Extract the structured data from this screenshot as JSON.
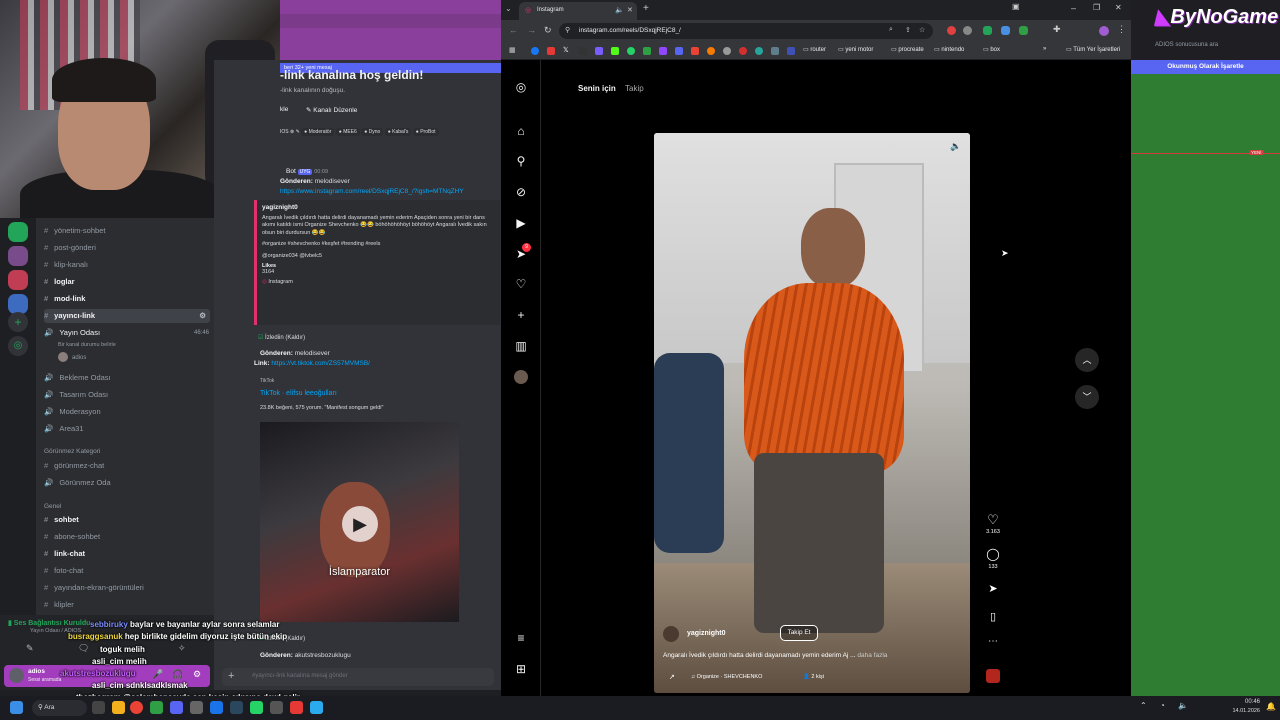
{
  "discord": {
    "channels_top": [
      "yönetim-sohbet",
      "post-gönderi",
      "klip-kanalı",
      "loglar",
      "mod-link",
      "yayıncı-link"
    ],
    "voice_room": "Yayın Odası",
    "voice_sub": "Bir kanal durumu belirle",
    "voice_user": "adios",
    "voice_count": "46:46",
    "rooms": [
      "Bekleme Odası",
      "Tasarım Odası",
      "Moderasyon",
      "Area31"
    ],
    "cat_hidden": "Görünmez Kategori",
    "hidden_channels": [
      "görünmez-chat",
      "Görünmez Oda"
    ],
    "cat_general": "Genel",
    "general_channels": [
      "sohbet",
      "abone-sohbet",
      "link-chat",
      "foto-chat",
      "yayından-ekran-görüntüleri",
      "klipler"
    ],
    "voice_status": "Ses Bağlantısı Kuruldu",
    "voice_status_sub": "Yayın Odası / ADIOS",
    "self_user": "adios",
    "self_status": "Sessi aramada",
    "new_msg_banner": "beri 32+ yeni mesaj",
    "welcome": "-link kanalına hoş geldin!",
    "welcome_sub": "-link kanalının doğuşu.",
    "edit_btn": "Kanalı Düzenle",
    "edit_btn_left": "kle",
    "roles": [
      "Moderatör",
      "MEE6",
      "Dyno",
      "Kabal's",
      "ProBot"
    ],
    "msg1_author": "Bot",
    "msg1_tag": "UYG",
    "msg1_time": "00:09",
    "msg1_from_label": "Gönderen:",
    "msg1_from": "melodisever",
    "msg1_link": "https://www.instagram.com/reel/DSxqjREjC8_/?igsh=MTNqZHY",
    "msg1_user": "yagiznight0",
    "msg1_body": "Angaralı İvedik çıldırdı hatta delirdi dayanamadı yemin ederim Apaçiden sonra yeni bir dans akımı katıldı ismi Organize Shevchenko 😂😂 böhöhöhöhöyt böhöhöyt Angaralı İvedik sakın olsun biri durdursun 😂😂",
    "msg1_tags": "#organize #shevchenko #keşfet #trending #reels",
    "msg1_mentions": "@organize034 @lvbelc5",
    "msg1_likes_label": "Likes",
    "msg1_likes": "3164",
    "msg1_source": "Instagram",
    "watched": "İzlediin (Kaldır)",
    "msg2_from_label": "Gönderen:",
    "msg2_from": "melodisever",
    "msg2_link_label": "Link:",
    "msg2_link": "https://vt.tiktok.com/ZS57MVMSB/",
    "tiktok_label": "TikTok",
    "tiktok_title": "TikTok · elifsu leeoğulları",
    "tiktok_meta": "23.8K beğeni, 575 yorum. \"Manifest songum geldi\"",
    "video_caption": "İslamparator",
    "watched2": "İzlediin (Kaldır)",
    "msg3_from_label": "Gönderen:",
    "msg3_from": "akutstresbozuklugu",
    "input_placeholder": "#yayıncı-link kanalına mesaj gönder"
  },
  "browser": {
    "tab_title": "Instagram",
    "url": "instagram.com/reels/DSxqjREjC8_/",
    "bookmarks": [
      "router",
      "yeni motor",
      "procreate",
      "nintendo",
      "box"
    ],
    "bookmarks_all": "Tüm Yer İşaretleri"
  },
  "instagram": {
    "tab_for_you": "Senin için",
    "tab_following": "Takip",
    "notif_count": "9",
    "likes": "3.163",
    "comments": "133",
    "user": "yagiznight0",
    "follow": "Takip Et",
    "caption": "Angaralı İvedik çıldırdı hatta delirdi dayanamadı yemin ederim Aj ...",
    "more": "daha fazla",
    "audio": "Organize · SHEVCHENKO",
    "people": "2 kişi"
  },
  "right_panel": {
    "brand": "ByNoGame",
    "sub": "ADIOS sonucusuna ara",
    "mark_read": "Okunmuş Olarak İşaretle",
    "new_badge": "YENİ"
  },
  "chat_overlay": [
    {
      "user": "sebbiruky",
      "msg": "baylar ve bayanlar aylar sonra selamlar",
      "color": "#7b8cff"
    },
    {
      "user": "busraggsanuk",
      "msg": "hep birlikte gidelim diyoruz işte bütün ekip",
      "color": "#f0d840"
    },
    {
      "user": "toguk",
      "msg": "melih",
      "color": "#ffffff"
    },
    {
      "user": "asli_cim",
      "msg": "melih",
      "color": "#ffffff"
    },
    {
      "user": "akutstresbozuklugu",
      "msg": "",
      "color": "#c45cff"
    },
    {
      "user": "asli_cim",
      "msg": "sdnklsadklsmak",
      "color": "#ffffff"
    },
    {
      "user": "thezhegram",
      "msg": "@selambenseyda sen kesin çıkışına dewl gelir",
      "color": "#ffffff"
    }
  ],
  "taskbar": {
    "search": "Ara",
    "time": "00:46",
    "date": "14.01.2026"
  }
}
